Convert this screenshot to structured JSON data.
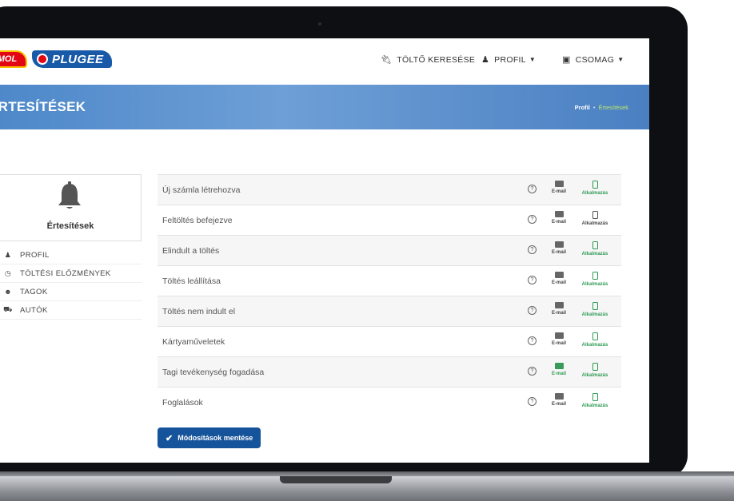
{
  "header": {
    "logo_mol": "MOL",
    "logo_plugee": "PLUGEE",
    "nav": [
      {
        "icon": "plug-icon",
        "label": "TÖLTŐ KERESÉSE",
        "has_dropdown": false
      },
      {
        "icon": "user-icon",
        "label": "PROFIL",
        "has_dropdown": true
      },
      {
        "icon": "briefcase-icon",
        "label": "CSOMAG",
        "has_dropdown": true
      }
    ]
  },
  "banner": {
    "title": "ÉRTESÍTÉSEK",
    "breadcrumb": {
      "parent": "Profil",
      "separator": "•",
      "current": "Értesítések"
    }
  },
  "sidebar": {
    "card_label": "Értesítések",
    "items": [
      {
        "icon": "user-icon",
        "label": "PROFIL"
      },
      {
        "icon": "clock-icon",
        "label": "TÖLTÉSI ELŐZMÉNYEK"
      },
      {
        "icon": "users-icon",
        "label": "TAGOK"
      },
      {
        "icon": "car-icon",
        "label": "AUTÓK"
      }
    ]
  },
  "notifications": {
    "email_label": "E-mail",
    "app_label": "Alkalmazás",
    "help_symbol": "?",
    "rows": [
      {
        "label": "Új számla létrehozva",
        "email": false,
        "app": true
      },
      {
        "label": "Feltöltés befejezve",
        "email": false,
        "app": false
      },
      {
        "label": "Elindult a töltés",
        "email": false,
        "app": true
      },
      {
        "label": "Töltés leállítása",
        "email": false,
        "app": true
      },
      {
        "label": "Töltés nem indult el",
        "email": false,
        "app": true
      },
      {
        "label": "Kártyaműveletek",
        "email": false,
        "app": true
      },
      {
        "label": "Tagi tevékenység fogadása",
        "email": true,
        "app": true
      },
      {
        "label": "Foglalások",
        "email": false,
        "app": true
      }
    ]
  },
  "save_button": {
    "label": "Módosítások mentése",
    "icon": "check-icon"
  },
  "colors": {
    "accent": "#15539a",
    "banner": "#5a90cf",
    "enabled": "#2f9a55",
    "disabled": "#555555"
  }
}
